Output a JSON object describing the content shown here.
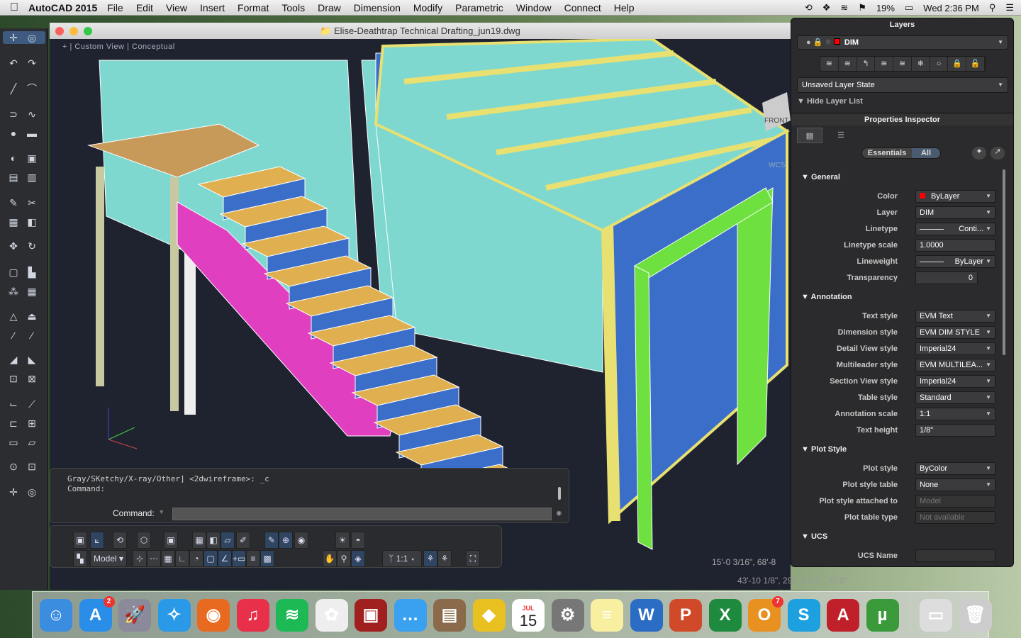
{
  "menubar": {
    "app": "AutoCAD 2015",
    "items": [
      "File",
      "Edit",
      "View",
      "Insert",
      "Format",
      "Tools",
      "Draw",
      "Dimension",
      "Modify",
      "Parametric",
      "Window",
      "Connect",
      "Help"
    ],
    "battery": "19%",
    "clock": "Wed 2:36 PM"
  },
  "window": {
    "title": "Elise-Deathtrap Technical Drafting_jun19.dwg",
    "view_label": "Custom View",
    "visual_style": "Conceptual",
    "viewcube_label": "FRONT",
    "wcs_label": "WCS"
  },
  "command": {
    "history_line": "Gray/SKetchy/X-ray/Other] <2dwireframe>: _c",
    "history_line2": "Command:",
    "prompt": "Command:",
    "input_value": ""
  },
  "statusbar": {
    "model": "Model",
    "scale": "1:1"
  },
  "coords": {
    "cursor": "15'-0 3/16\", 68'-8",
    "secondary": "43'-10 1/8\", 290'-6 1/2\" , 0'-0\""
  },
  "layers": {
    "title": "Layers",
    "current_layer": "DIM",
    "current_color": "#ff0000",
    "layer_state": "Unsaved Layer State",
    "hide_list": "Hide Layer List"
  },
  "properties": {
    "title": "Properties Inspector",
    "tabs": [
      "Essentials",
      "All"
    ],
    "active_tab": "All",
    "sections": {
      "general": "General",
      "annotation": "Annotation",
      "plot": "Plot Style",
      "ucs": "UCS"
    },
    "general": [
      {
        "label": "Color",
        "value": "ByLayer"
      },
      {
        "label": "Layer",
        "value": "DIM"
      },
      {
        "label": "Linetype",
        "value": "Conti..."
      },
      {
        "label": "Linetype scale",
        "value": "1.0000"
      },
      {
        "label": "Lineweight",
        "value": "ByLayer"
      },
      {
        "label": "Transparency",
        "value": "0"
      }
    ],
    "annotation": [
      {
        "label": "Text style",
        "value": "EVM Text"
      },
      {
        "label": "Dimension style",
        "value": "EVM DIM STYLE"
      },
      {
        "label": "Detail View style",
        "value": "Imperial24"
      },
      {
        "label": "Multileader style",
        "value": "EVM MULTILEA..."
      },
      {
        "label": "Section View style",
        "value": "Imperial24"
      },
      {
        "label": "Table style",
        "value": "Standard"
      },
      {
        "label": "Annotation scale",
        "value": "1:1"
      },
      {
        "label": "Text height",
        "value": "1/8\""
      }
    ],
    "plot": [
      {
        "label": "Plot style",
        "value": "ByColor"
      },
      {
        "label": "Plot style table",
        "value": "None"
      },
      {
        "label": "Plot style attached to",
        "value": "Model"
      },
      {
        "label": "Plot table type",
        "value": "Not available"
      }
    ],
    "ucs": [
      {
        "label": "UCS Name",
        "value": ""
      }
    ]
  },
  "dock": {
    "appstore_badge": "2",
    "calendar_month": "JUL",
    "calendar_day": "15",
    "outlook_badge": "7"
  },
  "colors": {
    "viewport_bg": "#1f2330",
    "wall": "#7fd8cf",
    "frame": "#e8e070",
    "stair_tread": "#e0b050",
    "stair_riser": "#3a6ec8",
    "stringer": "#e040c0",
    "door": "#6ee040"
  }
}
